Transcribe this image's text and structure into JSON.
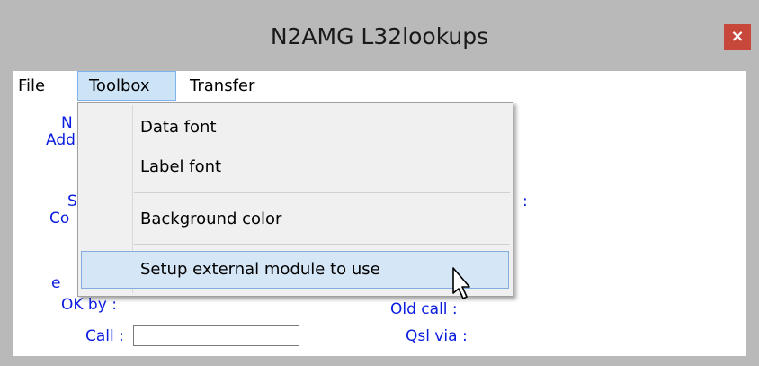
{
  "window": {
    "title": "N2AMG L32lookups",
    "close_label": "×"
  },
  "menubar": {
    "file": "File",
    "toolbox": "Toolbox",
    "transfer": "Transfer"
  },
  "toolbox_menu": {
    "items": [
      "Data font",
      "Label font",
      "Background color",
      "Setup external module to use"
    ]
  },
  "form": {
    "left_labels_partial": [
      "N",
      "Add",
      "S",
      "Co",
      "e"
    ],
    "ok_by_label": "OK by :",
    "call_label": "Call :",
    "call_value": "",
    "old_call_label": "Old call :",
    "qsl_via_label": "Qsl via :",
    "right_partial": ":"
  },
  "colors": {
    "label_blue": "#0a1ce0",
    "menu_highlight": "#cde4f7",
    "close_red": "#c7473a"
  }
}
